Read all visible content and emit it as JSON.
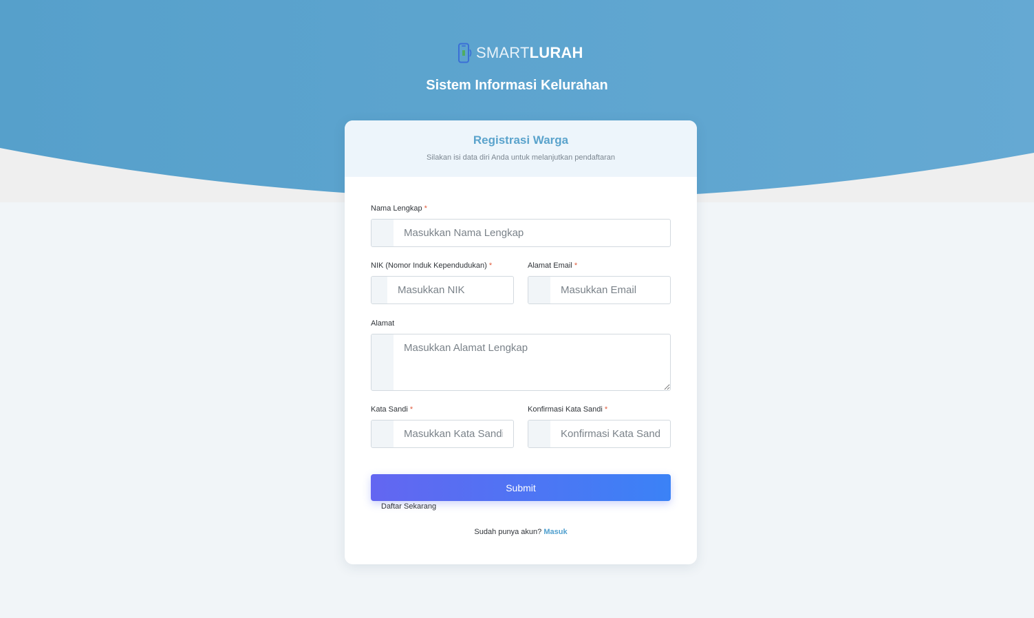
{
  "brand": {
    "logo_light": "SMART",
    "logo_bold": "LURAH",
    "logo_icon": "smartphone-icon",
    "app_title": "Sistem Informasi Kelurahan",
    "primary_color": "#5ba4cf"
  },
  "card": {
    "title": "Registrasi Warga",
    "subtitle": "Silakan isi data diri Anda untuk melanjutkan pendaftaran"
  },
  "form": {
    "required_mark": "*",
    "nama": {
      "label": "Nama Lengkap",
      "placeholder": "Masukkan Nama Lengkap"
    },
    "nik": {
      "label": "NIK (Nomor Induk Kependudukan)",
      "placeholder": "Masukkan NIK"
    },
    "email": {
      "label": "Alamat Email",
      "placeholder": "Masukkan Email"
    },
    "alamat": {
      "label": "Alamat",
      "placeholder": "Masukkan Alamat Lengkap"
    },
    "password": {
      "label": "Kata Sandi",
      "placeholder": "Masukkan Kata Sandi"
    },
    "password_confirm": {
      "label": "Konfirmasi Kata Sandi",
      "placeholder": "Konfirmasi Kata Sandi"
    },
    "submit_label": "Submit",
    "submit_gradient": [
      "#6366f1",
      "#3b82f6"
    ],
    "daftar_label": "Daftar Sekarang"
  },
  "footer": {
    "login_prompt": "Sudah punya akun?",
    "login_link": "Masuk"
  }
}
